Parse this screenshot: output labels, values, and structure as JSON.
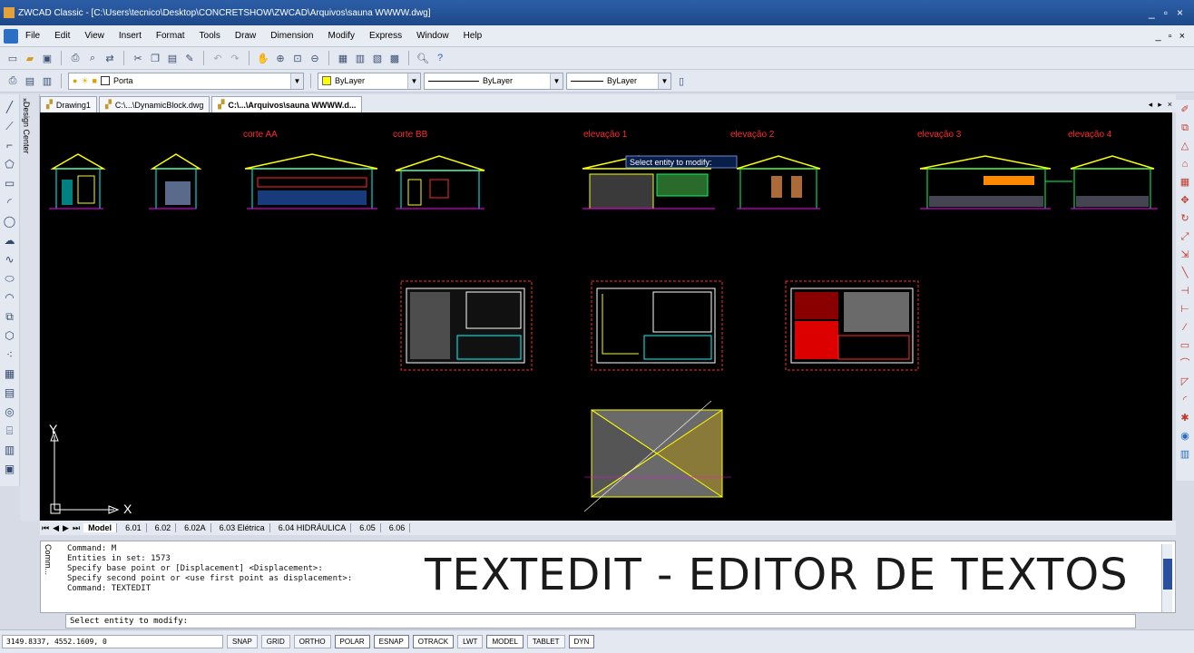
{
  "window": {
    "title": "ZWCAD Classic - [C:\\Users\\tecnico\\Desktop\\CONCRETSHOW\\ZWCAD\\Arquivos\\sauna WWWW.dwg]",
    "controls": [
      "_",
      "▫",
      "×"
    ]
  },
  "menu": {
    "items": [
      "File",
      "Edit",
      "View",
      "Insert",
      "Format",
      "Tools",
      "Draw",
      "Dimension",
      "Modify",
      "Express",
      "Window",
      "Help"
    ],
    "doc_controls": [
      "_",
      "▫",
      "×"
    ]
  },
  "properties": {
    "layer_value": "Porta",
    "color_value": "ByLayer",
    "linetype_value": "ByLayer",
    "lineweight_value": "ByLayer"
  },
  "design_center": {
    "label": "Design Center",
    "close": "×"
  },
  "doc_tabs": [
    {
      "label": "Drawing1"
    },
    {
      "label": "C:\\...\\DynamicBlock.dwg"
    },
    {
      "label": "C:\\...\\Arquivos\\sauna WWWW.d..."
    }
  ],
  "doc_tabs_nav": [
    "◂",
    "▸",
    "×"
  ],
  "drawing": {
    "labels": [
      "corte AA",
      "corte BB",
      "elevação 1",
      "elevação 2",
      "elevação 3",
      "elevação 4"
    ],
    "tooltip": "Select entity to modify:",
    "ucs_x": "X",
    "ucs_y": "Y",
    "colors": {
      "red_label": "#ff2a2a",
      "yellow": "#ffff00",
      "cyan": "#00ffff",
      "magenta": "#ff00ff",
      "background": "#000000"
    }
  },
  "layout_tabs": [
    "Model",
    "6.01",
    "6.02",
    "6.02A",
    "6.03 Elétrica",
    "6.04 HIDRÁULICA",
    "6.05",
    "6.06"
  ],
  "command": {
    "label": "Comm...",
    "lines": [
      "Command: M",
      "Entities in set: 1573",
      "Specify base point or [Displacement] <Displacement>:",
      "Specify second point or <use first point as displacement>:",
      "Command: TEXTEDIT"
    ],
    "prompt": "Select entity to modify:",
    "overlay_caption": "TEXTEDIT - EDITOR DE TEXTOS"
  },
  "status": {
    "coords": "3149.8337, 4552.1609, 0",
    "buttons": [
      "SNAP",
      "GRID",
      "ORTHO",
      "POLAR",
      "ESNAP",
      "OTRACK",
      "LWT",
      "MODEL",
      "TABLET",
      "DYN"
    ]
  }
}
